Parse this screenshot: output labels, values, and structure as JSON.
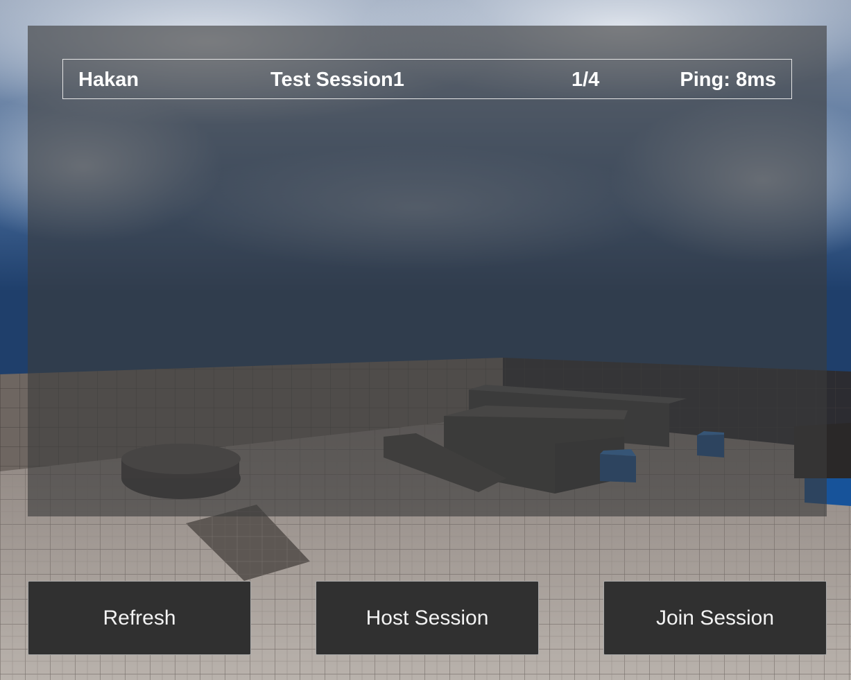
{
  "sessions": [
    {
      "host": "Hakan",
      "name": "Test Session1",
      "players": "1/4",
      "ping": "Ping: 8ms"
    }
  ],
  "buttons": {
    "refresh": "Refresh",
    "host": "Host Session",
    "join": "Join Session"
  },
  "colors": {
    "panel_overlay": "#3c3c3c",
    "button_bg": "#303030",
    "text": "#ffffff",
    "accent_cube": "#1a64b8"
  }
}
